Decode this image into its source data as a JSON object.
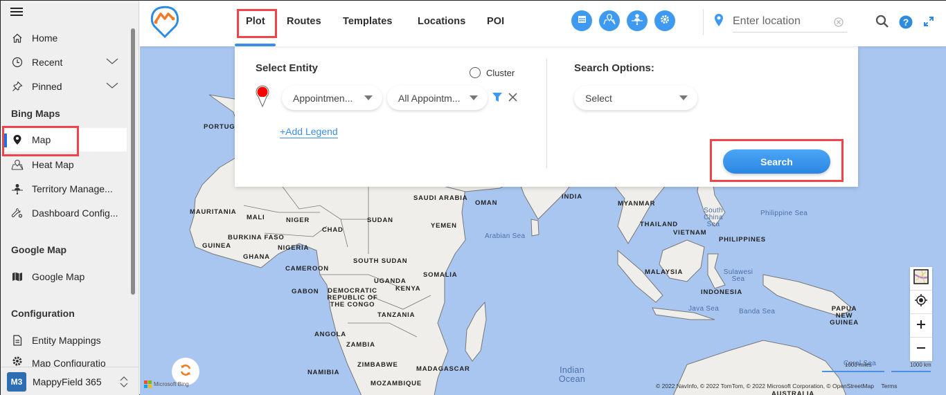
{
  "sidebar": {
    "items": [
      {
        "label": "Home",
        "icon": "home-icon"
      },
      {
        "label": "Recent",
        "icon": "clock-icon",
        "expandable": true
      },
      {
        "label": "Pinned",
        "icon": "pin-icon",
        "expandable": true
      }
    ],
    "sections": [
      {
        "title": "Bing Maps",
        "items": [
          {
            "label": "Map",
            "icon": "map-marker-icon",
            "active": true
          },
          {
            "label": "Heat Map",
            "icon": "heat-map-icon"
          },
          {
            "label": "Territory Manage...",
            "icon": "territory-icon"
          },
          {
            "label": "Dashboard Config...",
            "icon": "wrench-gear-icon"
          }
        ]
      },
      {
        "title": "Google Map",
        "items": [
          {
            "label": "Google Map",
            "icon": "folded-map-icon"
          }
        ]
      },
      {
        "title": "Configuration",
        "items": [
          {
            "label": "Entity Mappings",
            "icon": "document-icon"
          },
          {
            "label": "Map Configuratio",
            "icon": "gear-icon"
          }
        ]
      }
    ],
    "footer": {
      "badge": "M3",
      "app_name": "MappyField 365"
    }
  },
  "topbar": {
    "tabs": [
      {
        "label": "Plot",
        "active": true
      },
      {
        "label": "Routes"
      },
      {
        "label": "Templates"
      },
      {
        "label": "Locations"
      },
      {
        "label": "POI"
      }
    ],
    "action_icons": [
      "calendar-icon",
      "map-location-icon",
      "territory-icon",
      "settings-icon"
    ],
    "location_placeholder": "Enter location",
    "accent_color": "#3d9af0"
  },
  "panel": {
    "select_entity_title": "Select Entity",
    "cluster_label": "Cluster",
    "entity_dropdown": "Appointmen...",
    "view_dropdown": "All Appointm...",
    "add_legend": "+Add Legend",
    "search_options_title": "Search Options:",
    "search_options_value": "Select",
    "search_button": "Search",
    "marker_color": "#ff0000"
  },
  "map": {
    "labels": [
      {
        "text": "PORTUGA",
        "kind": "country"
      },
      {
        "text": "MAURITANIA",
        "kind": "country"
      },
      {
        "text": "MALI",
        "kind": "country"
      },
      {
        "text": "NIGER",
        "kind": "country"
      },
      {
        "text": "CHAD",
        "kind": "country"
      },
      {
        "text": "SUDAN",
        "kind": "country"
      },
      {
        "text": "BURKINA FASO",
        "kind": "country"
      },
      {
        "text": "GUINEA",
        "kind": "country"
      },
      {
        "text": "GHANA",
        "kind": "country"
      },
      {
        "text": "NIGERIA",
        "kind": "country"
      },
      {
        "text": "CAMEROON",
        "kind": "country"
      },
      {
        "text": "SOUTH SUDAN",
        "kind": "country"
      },
      {
        "text": "GABON",
        "kind": "country"
      },
      {
        "text": "UGANDA",
        "kind": "country"
      },
      {
        "text": "KENYA",
        "kind": "country"
      },
      {
        "text": "DEMOCRATIC REPUBLIC OF THE CONGO",
        "kind": "country"
      },
      {
        "text": "TANZANIA",
        "kind": "country"
      },
      {
        "text": "SOMALIA",
        "kind": "country"
      },
      {
        "text": "ANGOLA",
        "kind": "country"
      },
      {
        "text": "ZAMBIA",
        "kind": "country"
      },
      {
        "text": "ZIMBABWE",
        "kind": "country"
      },
      {
        "text": "NAMIBIA",
        "kind": "country"
      },
      {
        "text": "MOZAMBIQUE",
        "kind": "country"
      },
      {
        "text": "MADAGASCAR",
        "kind": "country"
      },
      {
        "text": "SAUDI ARABIA",
        "kind": "country"
      },
      {
        "text": "OMAN",
        "kind": "country"
      },
      {
        "text": "YEMEN",
        "kind": "country"
      },
      {
        "text": "INDIA",
        "kind": "country"
      },
      {
        "text": "MYANMAR",
        "kind": "country"
      },
      {
        "text": "THAILAND",
        "kind": "country"
      },
      {
        "text": "VIETNAM",
        "kind": "country"
      },
      {
        "text": "PHILIPPINES",
        "kind": "country"
      },
      {
        "text": "MALAYSIA",
        "kind": "country"
      },
      {
        "text": "INDONESIA",
        "kind": "country"
      },
      {
        "text": "PAPUA NEW GUINEA",
        "kind": "country"
      },
      {
        "text": "AUSTRALIA",
        "kind": "country"
      },
      {
        "text": "Arabian Sea",
        "kind": "sea"
      },
      {
        "text": "South China Sea",
        "kind": "sea"
      },
      {
        "text": "Philippine Sea",
        "kind": "sea"
      },
      {
        "text": "Sulawesi Sea",
        "kind": "sea"
      },
      {
        "text": "Java Sea",
        "kind": "sea"
      },
      {
        "text": "Banda Sea",
        "kind": "sea"
      },
      {
        "text": "Indian Ocean",
        "kind": "sea"
      },
      {
        "text": "Coral Sea",
        "kind": "sea"
      }
    ],
    "scale_miles": "1000 miles",
    "scale_km": "1000 km",
    "attribution": "© 2022 NavInfo, © 2022 TomTom, © 2022 Microsoft Corporation, © OpenStreetMap",
    "terms": "Terms",
    "provider": "Microsoft Bing"
  }
}
